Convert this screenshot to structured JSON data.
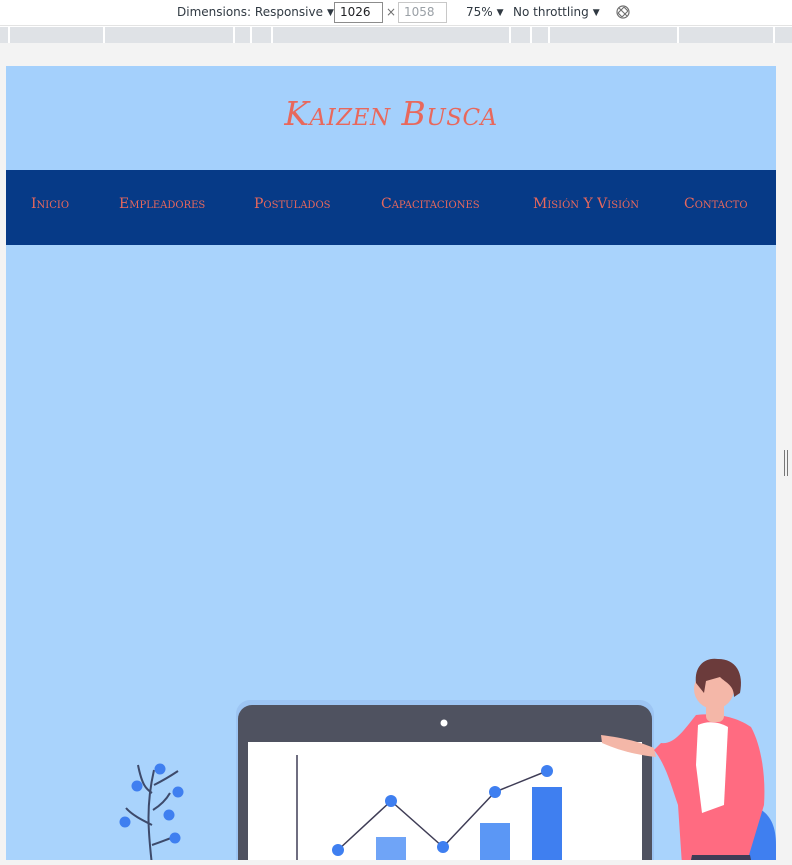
{
  "devtools": {
    "dimensions_label": "Dimensions: Responsive",
    "width_value": "1026",
    "height_value": "1058",
    "times": "×",
    "zoom": "75%",
    "throttling": "No throttling"
  },
  "site": {
    "title": "Kaizen Busca"
  },
  "nav": {
    "items": [
      {
        "label": "Inicio"
      },
      {
        "label": "Empleadores"
      },
      {
        "label": "Postulados"
      },
      {
        "label": "Capacitaciones"
      },
      {
        "label": "Misión Y Visión"
      },
      {
        "label": "Contacto"
      }
    ]
  },
  "colors": {
    "page_bg": "#a4d0fc",
    "nav_bg": "#063a87",
    "accent": "#e8685c",
    "monitor": "#4f5260",
    "chart_blue": "#4285f4"
  },
  "icons": {
    "rotate": "rotate-disabled-icon",
    "resize": "resize-handle-icon"
  }
}
